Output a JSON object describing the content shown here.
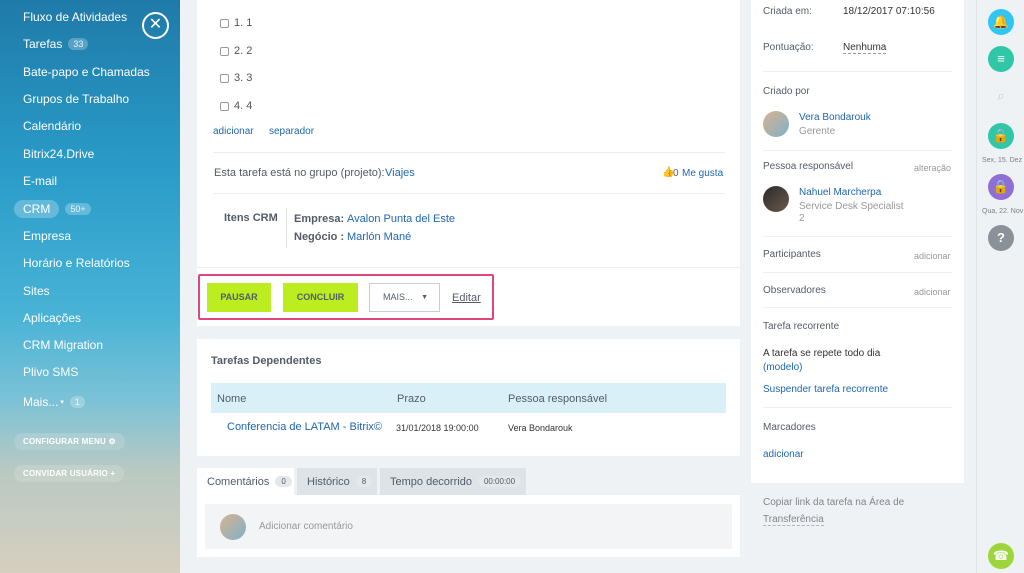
{
  "sidebar": {
    "items": [
      {
        "label": "Fluxo de Atividades"
      },
      {
        "label": "Tarefas",
        "counter": "33"
      },
      {
        "label": "Bate-papo e Chamadas"
      },
      {
        "label": "Grupos de Trabalho"
      },
      {
        "label": "Calendário"
      },
      {
        "label": "Bitrix24.Drive"
      },
      {
        "label": "E-mail"
      },
      {
        "label": "CRM",
        "counter": "50+"
      },
      {
        "label": "Empresa"
      },
      {
        "label": "Horário e Relatórios"
      },
      {
        "label": "Sites"
      },
      {
        "label": "Aplicações"
      },
      {
        "label": "CRM Migration"
      },
      {
        "label": "Plivo SMS"
      },
      {
        "label": "Mais...",
        "counter": "1"
      }
    ],
    "configure_menu": "CONFIGURAR MENU",
    "invite_users": "CONVIDAR USUÁRIO",
    "close_icon": "close-icon"
  },
  "task": {
    "checklist": [
      "1. 1",
      "2. 2",
      "3. 3",
      "4. 4"
    ],
    "add_link": "adicionar",
    "separator_link": "separador",
    "group_text": "Esta tarefa está no grupo (projeto):",
    "group_name": "Viajes",
    "likes_count": "0",
    "like_label": "Me gusta",
    "crm_items_label": "Itens CRM",
    "company_label": "Empresa:",
    "company_value": "Avalon Punta del Este",
    "deal_label": "Negócio :",
    "deal_value": "Marlón Mané"
  },
  "actions": {
    "pause": "PAUSAR",
    "complete": "CONCLUIR",
    "more": "MAIS...",
    "edit": "Editar",
    "accent": "#bbed21",
    "highlight": "#e0457b"
  },
  "dependent": {
    "title": "Tarefas Dependentes",
    "columns": [
      "Nome",
      "Prazo",
      "Pessoa responsável"
    ],
    "rows": [
      {
        "name": "Conferencia de LATAM - Bitrix©",
        "deadline": "31/01/2018 19:00:00",
        "responsible": "Vera Bondarouk"
      }
    ]
  },
  "tabs": [
    {
      "label": "Comentários",
      "badge": "0"
    },
    {
      "label": "Histórico",
      "badge": "8"
    },
    {
      "label": "Tempo decorrido",
      "badge": "00:00:00"
    }
  ],
  "comment_placeholder": "Adicionar comentário",
  "details": {
    "created_label": "Criada em:",
    "created_value": "18/12/2017 07:10:56",
    "score_label": "Pontuação:",
    "score_value": "Nenhuma",
    "created_by_label": "Criado por",
    "creator_name": "Vera Bondarouk",
    "creator_role": "Gerente",
    "responsible_label": "Pessoa responsável",
    "change_link": "alteração",
    "responsible_name": "Nahuel Marcherpa",
    "responsible_role": "Service Desk Specialist",
    "responsible_extra": "2",
    "participants_label": "Participantes",
    "participants_add": "adicionar",
    "observers_label": "Observadores",
    "observers_add": "adicionar",
    "recurring_label": "Tarefa recorrente",
    "recurring_text": "A tarefa se repete todo dia",
    "recurring_model": "(modelo)",
    "suspend_link": "Suspender tarefa recorrente",
    "tags_label": "Marcadores",
    "tags_add": "adicionar",
    "copy_link_1": "Copiar link da tarefa na Área de",
    "copy_link_2": "Transferência"
  },
  "rail": {
    "date1": "Sex, 15. Dez",
    "date2": "Qua, 22. Nov",
    "question": "?"
  }
}
